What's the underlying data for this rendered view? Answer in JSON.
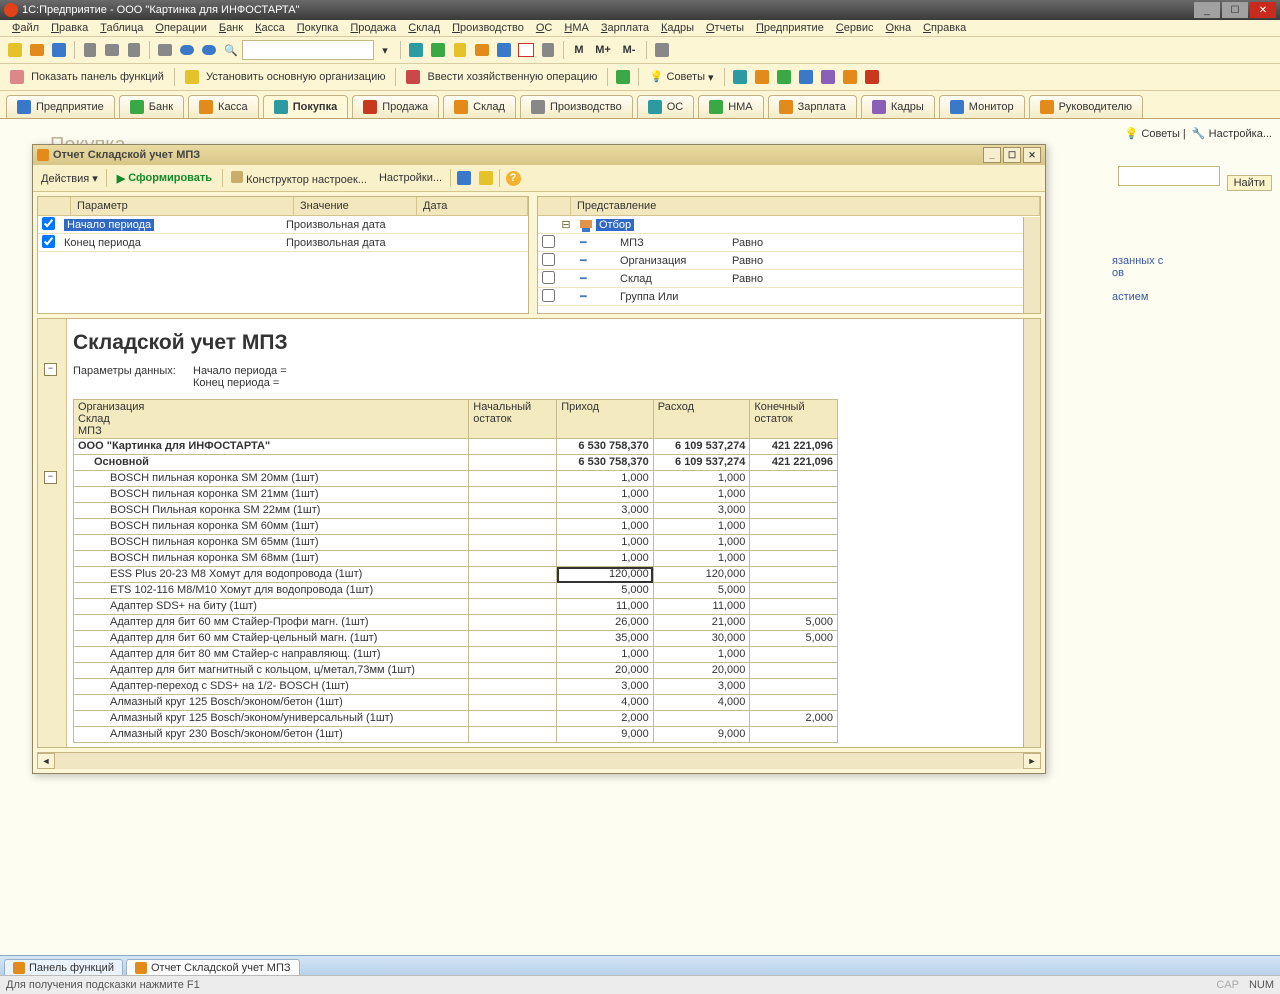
{
  "title": "1С:Предприятие - ООО \"Картинка для ИНФОСТАРТА\"",
  "menu": [
    "Файл",
    "Правка",
    "Таблица",
    "Операции",
    "Банк",
    "Касса",
    "Покупка",
    "Продажа",
    "Склад",
    "Производство",
    "ОС",
    "НМА",
    "Зарплата",
    "Кадры",
    "Отчеты",
    "Предприятие",
    "Сервис",
    "Окна",
    "Справка"
  ],
  "toolbar2": {
    "panel": "Показать панель функций",
    "org": "Установить основную организацию",
    "biz": "Ввести хозяйственную операцию",
    "advice": "Советы"
  },
  "toolbar1_text": {
    "m": "M",
    "mplus": "M+",
    "mminus": "M-"
  },
  "tabs": [
    {
      "label": "Предприятие"
    },
    {
      "label": "Банк"
    },
    {
      "label": "Касса"
    },
    {
      "label": "Покупка",
      "active": true
    },
    {
      "label": "Продажа"
    },
    {
      "label": "Склад"
    },
    {
      "label": "Производство"
    },
    {
      "label": "ОС"
    },
    {
      "label": "НМА"
    },
    {
      "label": "Зарплата"
    },
    {
      "label": "Кадры"
    },
    {
      "label": "Монитор"
    },
    {
      "label": "Руководителю"
    }
  ],
  "bg_title": "Покупка",
  "side": {
    "advice": "Советы",
    "settings": "Настройка...",
    "find": "Найти",
    "link1": "язанных с",
    "link1b": "ов",
    "link2": "астием"
  },
  "modal": {
    "title": "Отчет  Складской учет МПЗ",
    "actions": "Действия",
    "form": "Сформировать",
    "construct": "Конструктор настроек...",
    "settings": "Настройки...",
    "params_head": {
      "p": "Параметр",
      "v": "Значение",
      "d": "Дата"
    },
    "params": [
      {
        "label": "Начало периода",
        "value": "Произвольная дата",
        "sel": true
      },
      {
        "label": "Конец периода",
        "value": "Произвольная дата"
      }
    ],
    "filter_head": "Представление",
    "filter_root": "Отбор",
    "filters": [
      {
        "label": "МПЗ",
        "op": "Равно"
      },
      {
        "label": "Организация",
        "op": "Равно"
      },
      {
        "label": "Склад",
        "op": "Равно"
      },
      {
        "label": "Группа Или",
        "op": ""
      }
    ],
    "report": {
      "title": "Складской учет МПЗ",
      "param_label": "Параметры данных:",
      "param_lines": [
        "Начало периода =",
        "Конец периода ="
      ],
      "cols": {
        "org": "Организация",
        "sklad": "Склад",
        "mpz": "МПЗ",
        "beg": "Начальный остаток",
        "in": "Приход",
        "out": "Расход",
        "end": "Конечный остаток"
      },
      "org_row": {
        "name": "ООО \"Картинка для ИНФОСТАРТА\"",
        "in": "6 530 758,370",
        "out": "6 109 537,274",
        "end": "421 221,096"
      },
      "sklad_row": {
        "name": "Основной",
        "in": "6 530 758,370",
        "out": "6 109 537,274",
        "end": "421 221,096"
      },
      "rows": [
        {
          "name": "BOSCH пильная коронка SM 20мм (1шт)",
          "in": "1,000",
          "out": "1,000"
        },
        {
          "name": "BOSCH пильная коронка SM 21мм (1шт)",
          "in": "1,000",
          "out": "1,000"
        },
        {
          "name": "BOSCH Пильная коронка SM 22мм (1шт)",
          "in": "3,000",
          "out": "3,000"
        },
        {
          "name": "BOSCH пильная коронка SM 60мм (1шт)",
          "in": "1,000",
          "out": "1,000"
        },
        {
          "name": "BOSCH пильная коронка SM 65мм (1шт)",
          "in": "1,000",
          "out": "1,000"
        },
        {
          "name": "BOSCH пильная коронка SM 68мм (1шт)",
          "in": "1,000",
          "out": "1,000"
        },
        {
          "name": "ESS Plus 20-23 M8 Хомут для водопровода    (1шт)",
          "in": "120,000",
          "out": "120,000",
          "hl": true
        },
        {
          "name": "ETS 102-116 M8/M10  Хомут для водопровода    (1шт)",
          "in": "5,000",
          "out": "5,000"
        },
        {
          "name": "Адаптер SDS+ на биту         (1шт)",
          "in": "11,000",
          "out": "11,000"
        },
        {
          "name": "Адаптер для бит 60 мм Стайер-Профи  магн.    (1шт)",
          "in": "26,000",
          "out": "21,000",
          "end": "5,000"
        },
        {
          "name": "Адаптер для бит 60 мм Стайер-цельный магн.   (1шт)",
          "in": "35,000",
          "out": "30,000",
          "end": "5,000"
        },
        {
          "name": "Адаптер для бит 80 мм Стайер-с направляющ.  (1шт)",
          "in": "1,000",
          "out": "1,000"
        },
        {
          "name": "Адаптер для бит магнитный с кольцом, ц/метал,73мм (1шт)",
          "in": "20,000",
          "out": "20,000"
        },
        {
          "name": "Адаптер-переход с SDS+ на 1/2- BOSCH       (1шт)",
          "in": "3,000",
          "out": "3,000"
        },
        {
          "name": "Алмазный круг 125 Bosch/эконом/бетон   (1шт)",
          "in": "4,000",
          "out": "4,000"
        },
        {
          "name": "Алмазный круг 125 Bosch/эконом/универсальный (1шт)",
          "in": "2,000",
          "out": "",
          "end": "2,000"
        },
        {
          "name": "Алмазный круг 230 Bosch/эконом/бетон (1шт)",
          "in": "9,000",
          "out": "9,000"
        }
      ]
    }
  },
  "wintabs": [
    {
      "label": "Панель функций"
    },
    {
      "label": "Отчет  Складской учет МПЗ",
      "active": true
    }
  ],
  "status": {
    "hint": "Для получения подсказки нажмите F1",
    "cap": "CAP",
    "num": "NUM"
  }
}
